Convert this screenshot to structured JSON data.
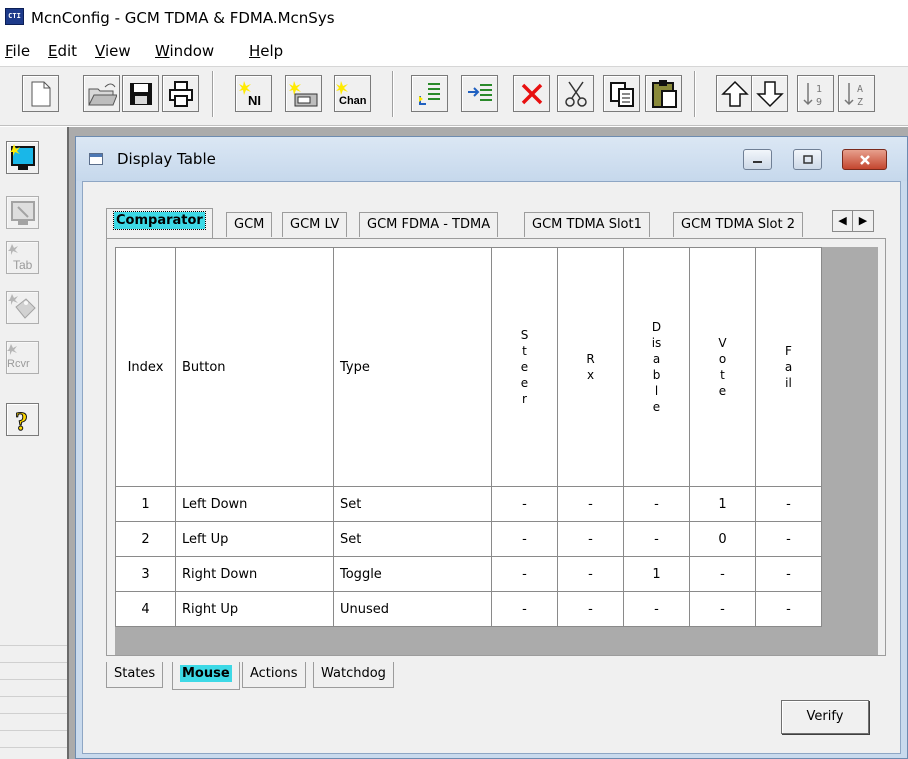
{
  "window": {
    "icon_text": "CTI",
    "title": "McnConfig - GCM TDMA & FDMA.McnSys"
  },
  "menu": [
    "File",
    "Edit",
    "View",
    "Window",
    "Help"
  ],
  "toolbar": {
    "buttons": [
      {
        "name": "new-file-button",
        "icon": "new-document-icon"
      },
      {
        "name": "open-file-button",
        "icon": "open-folder-icon"
      },
      {
        "name": "save-button",
        "icon": "floppy-disk-icon"
      },
      {
        "name": "print-button",
        "icon": "printer-icon"
      },
      {
        "name": "new-ni-button",
        "icon": "new-ni-icon",
        "label": "NI"
      },
      {
        "name": "new-device-button",
        "icon": "new-device-icon"
      },
      {
        "name": "new-chan-button",
        "icon": "new-chan-icon",
        "label": "Chan"
      },
      {
        "name": "insert-after-button",
        "icon": "insert-after-icon"
      },
      {
        "name": "insert-before-button",
        "icon": "insert-before-icon"
      },
      {
        "name": "delete-button",
        "icon": "red-x-icon"
      },
      {
        "name": "cut-button",
        "icon": "scissors-icon"
      },
      {
        "name": "copy-button",
        "icon": "copy-icon"
      },
      {
        "name": "paste-button",
        "icon": "clipboard-icon"
      },
      {
        "name": "move-up-button",
        "icon": "arrow-up-icon"
      },
      {
        "name": "move-down-button",
        "icon": "arrow-down-icon"
      },
      {
        "name": "sort-numeric-button",
        "icon": "sort-numeric-icon",
        "label": "19"
      },
      {
        "name": "sort-alpha-button",
        "icon": "sort-alpha-icon",
        "label": "AZ"
      }
    ]
  },
  "left_toolbar": [
    {
      "name": "display-window-button",
      "icon": "monitor-icon"
    },
    {
      "name": "display-config-button",
      "icon": "monitor-disabled-icon"
    },
    {
      "name": "new-tab-button",
      "icon": "new-tab-icon",
      "label": "Tab"
    },
    {
      "name": "new-tag-button",
      "icon": "new-tag-icon"
    },
    {
      "name": "new-rcvr-button",
      "icon": "new-rcvr-icon",
      "label": "Rcvr"
    },
    {
      "name": "help-button",
      "icon": "help-question-icon",
      "label": "?"
    }
  ],
  "child_window": {
    "title": "Display Table"
  },
  "top_tabs": [
    "Comparator",
    "GCM",
    "GCM LV",
    "GCM FDMA - TDMA",
    "GCM TDMA Slot1",
    "GCM TDMA Slot 2"
  ],
  "active_top_tab": "Comparator",
  "table": {
    "headers": {
      "index": "Index",
      "button": "Button",
      "type": "Type",
      "steer": "Steer",
      "rx": "Rx",
      "disable": "Disable",
      "vote": "Vote",
      "fail": "Fail"
    },
    "rows": [
      {
        "index": "1",
        "button": "Left Down",
        "type": "Set",
        "steer": "-",
        "rx": "-",
        "disable": "-",
        "vote": "1",
        "fail": "-"
      },
      {
        "index": "2",
        "button": "Left Up",
        "type": "Set",
        "steer": "-",
        "rx": "-",
        "disable": "-",
        "vote": "0",
        "fail": "-"
      },
      {
        "index": "3",
        "button": "Right Down",
        "type": "Toggle",
        "steer": "-",
        "rx": "-",
        "disable": "1",
        "vote": "-",
        "fail": "-"
      },
      {
        "index": "4",
        "button": "Right Up",
        "type": "Unused",
        "steer": "-",
        "rx": "-",
        "disable": "-",
        "vote": "-",
        "fail": "-"
      }
    ]
  },
  "bottom_tabs": [
    "States",
    "Mouse",
    "Actions",
    "Watchdog"
  ],
  "active_bottom_tab": "Mouse",
  "verify_label": "Verify"
}
